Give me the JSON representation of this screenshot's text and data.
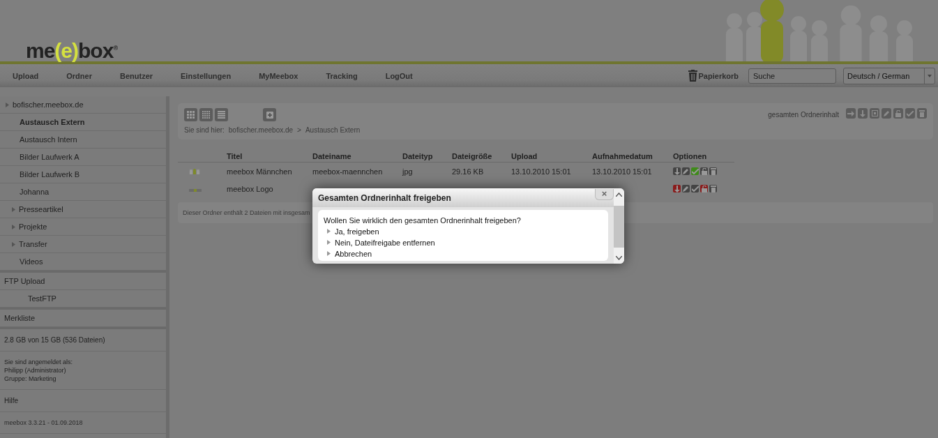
{
  "header": {
    "logo": {
      "before": "me",
      "bracketed": "(e)",
      "after": "box",
      "mark": "®"
    }
  },
  "nav": {
    "items": [
      "Upload",
      "Ordner",
      "Benutzer",
      "Einstellungen",
      "MyMeebox",
      "Tracking",
      "LogOut"
    ],
    "trash": "Papierkorb",
    "search": {
      "placeholder": "Suche"
    },
    "language": {
      "value": "Deutsch / German"
    }
  },
  "sidebar": {
    "folders": {
      "label": "bofischer.meebox.de",
      "expandable": true,
      "children": [
        {
          "label": "Austausch Extern",
          "expandable": false,
          "selected": true
        },
        {
          "label": "Austausch Intern",
          "expandable": false,
          "selected": false
        },
        {
          "label": "Bilder Laufwerk A",
          "expandable": false,
          "selected": false
        },
        {
          "label": "Bilder Laufwerk B",
          "expandable": false,
          "selected": false
        },
        {
          "label": "Johanna",
          "expandable": false,
          "selected": false
        },
        {
          "label": "Presseartikel",
          "expandable": true,
          "selected": false
        },
        {
          "label": "Projekte",
          "expandable": true,
          "selected": false
        },
        {
          "label": "Transfer",
          "expandable": true,
          "selected": false
        },
        {
          "label": "Videos",
          "expandable": false,
          "selected": false
        }
      ]
    },
    "ftp": {
      "label": "FTP Upload",
      "items": [
        "TestFTP"
      ]
    },
    "watchlist": "Merkliste",
    "storage": "2.8 GB von 15 GB (536 Dateien)",
    "login": [
      "Sie sind angemeldet als:",
      "Philipp (Administrator)",
      "Gruppe: Marketing"
    ],
    "help": "Hilfe",
    "version": "meebox 3.3.21 - 01.09.2018"
  },
  "toolbar": {
    "breadcrumb": {
      "label": "Sie sind hier:",
      "path": [
        "bofischer.meebox.de",
        "Austausch Extern"
      ],
      "separator": ">"
    },
    "bulk": {
      "label": "gesamten Ordnerinhalt"
    }
  },
  "table": {
    "columns": [
      "Titel",
      "Dateiname",
      "Dateityp",
      "Dateigröße",
      "Upload",
      "Aufnahmedatum",
      "Optionen"
    ],
    "rows": [
      {
        "cells": [
          "meebox Männchen",
          "meebox-maennchen",
          "jpg",
          "29.16 KB",
          "13.10.2010 15:01",
          "13.10.2010 15:01"
        ],
        "options": [
          {
            "kind": "download",
            "color": "#444444"
          },
          {
            "kind": "pencil",
            "color": "#444444"
          },
          {
            "kind": "check",
            "color": "#3f8a1a"
          },
          {
            "kind": "lock",
            "color": "#444444"
          },
          {
            "kind": "trash",
            "color": "#444444"
          }
        ]
      },
      {
        "cells": [
          "meebox Logo"
        ],
        "options": [
          {
            "kind": "download",
            "color": "#8a1c1c"
          },
          {
            "kind": "pencil",
            "color": "#444444"
          },
          {
            "kind": "check",
            "color": "#444444"
          },
          {
            "kind": "lock",
            "color": "#8a1c1c"
          },
          {
            "kind": "trash",
            "color": "#444444"
          }
        ]
      }
    ],
    "footer": "Dieser Ordner enthält 2 Dateien mit insgesam"
  },
  "dialog": {
    "title": "Gesamten Ordnerinhalt freigeben",
    "close": "×",
    "question": "Wollen Sie wirklich den gesamten Ordnerinhalt freigeben?",
    "options": [
      "Ja, freigeben",
      "Nein, Dateifreigabe entfernen",
      "Abbrechen"
    ]
  }
}
